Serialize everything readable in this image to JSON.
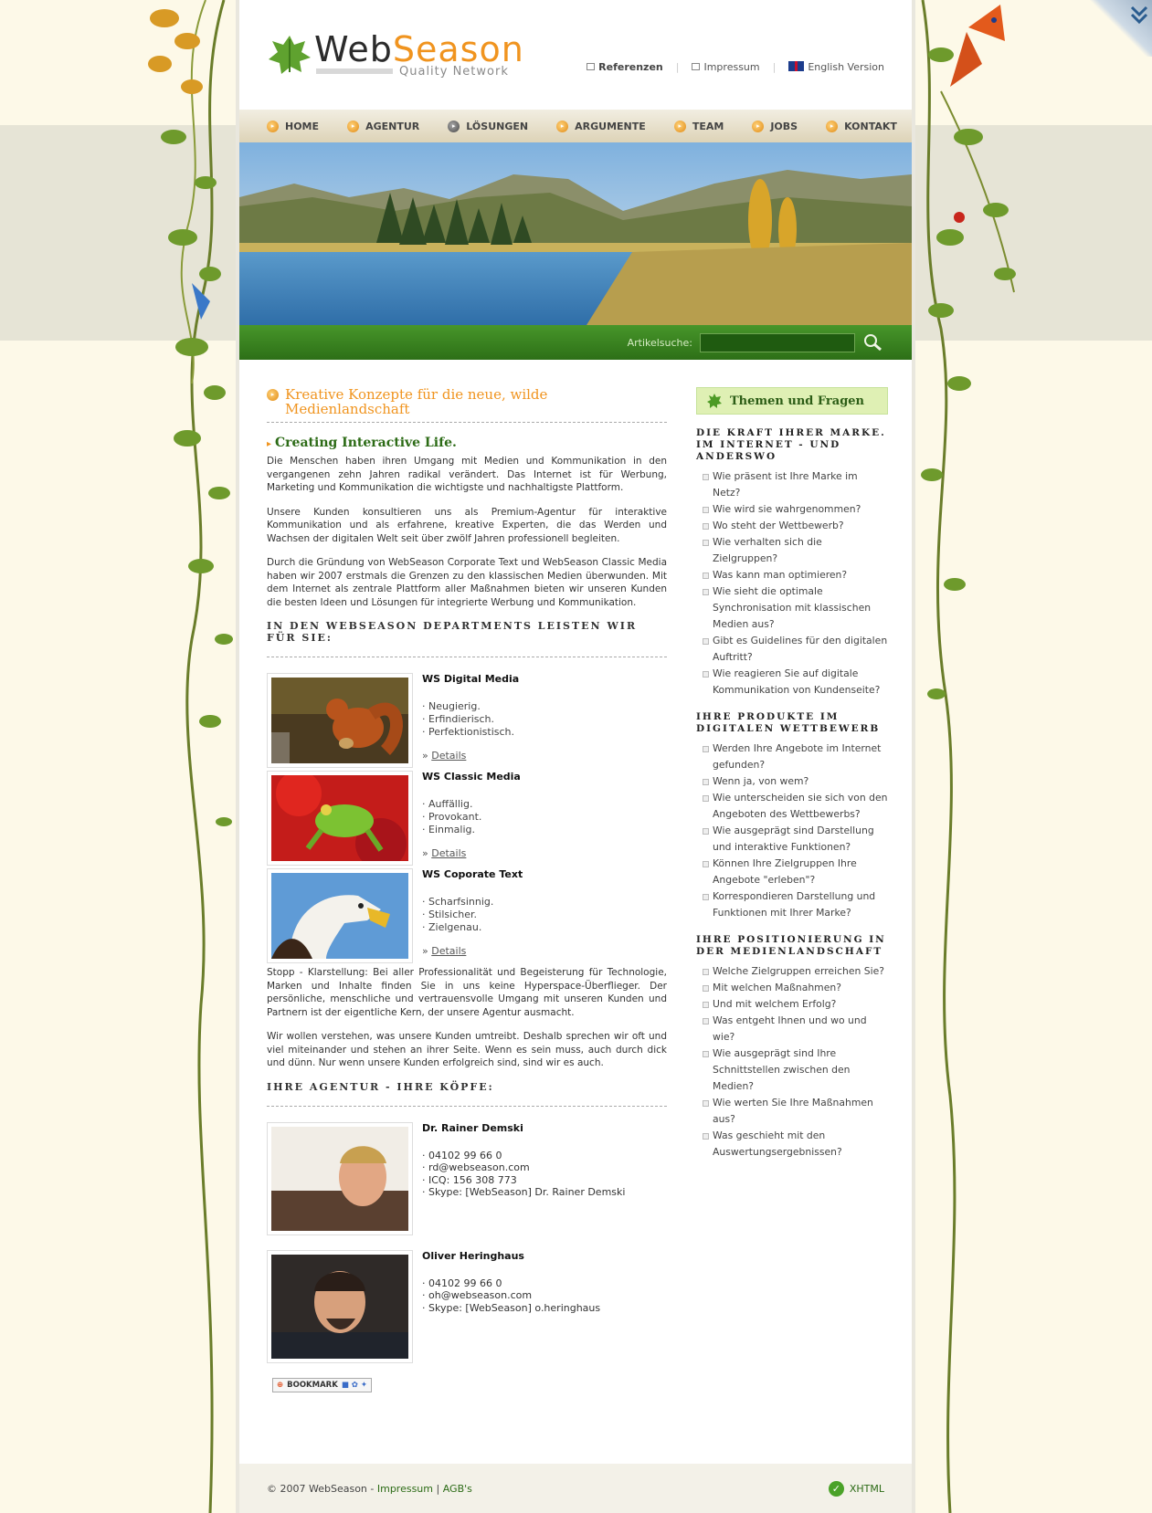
{
  "brand": {
    "name_part1": "Web",
    "name_part2": "Season",
    "tagline": "Quality Network"
  },
  "top_links": {
    "references": "Referenzen",
    "imprint": "Impressum",
    "english": "English Version"
  },
  "nav": [
    "HOME",
    "AGENTUR",
    "LÖSUNGEN",
    "ARGUMENTE",
    "TEAM",
    "JOBS",
    "KONTAKT"
  ],
  "nav_active": "LÖSUNGEN",
  "search": {
    "label": "Artikelsuche:",
    "value": ""
  },
  "content": {
    "heading": "Kreative Konzepte für die neue, wilde Medienlandschaft",
    "subheading": "Creating Interactive Life.",
    "para1": "Die Menschen haben ihren Umgang mit Medien und Kommunikation in den vergangenen zehn Jahren radikal verändert. Das Internet ist für Werbung, Marketing und Kommunikation die wichtigste und nachhaltigste Plattform.",
    "para2": "Unsere Kunden konsultieren uns als Premium-Agentur für interaktive Kommunikation und als erfahrene, kreative Experten, die das Werden und Wachsen der digitalen Welt seit über zwölf Jahren professionell begleiten.",
    "para3": "Durch die Gründung von WebSeason Corporate Text und WebSeason Classic Media haben wir 2007 erstmals die Grenzen zu den klassischen Medien überwunden. Mit dem Internet als zentrale Plattform aller Maßnahmen bieten wir unseren Kunden die besten Ideen und Lösungen für integrierte Werbung und Kommunikation.",
    "departments_heading": "IN DEN WEBSEASON DEPARTMENTS LEISTEN WIR FÜR SIE:",
    "departments": [
      {
        "name": "WS Digital Media",
        "lines": [
          "· Neugierig.",
          "· Erfindierisch.",
          "· Perfektionistisch."
        ],
        "details": "Details",
        "image": "squirrel"
      },
      {
        "name": "WS Classic Media",
        "lines": [
          "· Auffällig.",
          "· Provokant.",
          "· Einmalig."
        ],
        "details": "Details",
        "image": "frog"
      },
      {
        "name": "WS Coporate Text",
        "lines": [
          "· Scharfsinnig.",
          "· Stilsicher.",
          "· Zielgenau."
        ],
        "details": "Details",
        "image": "eagle"
      }
    ],
    "para4": "Stopp - Klarstellung: Bei aller Professionalität und Begeisterung für Technologie, Marken und Inhalte finden Sie in uns keine Hyperspace-Überflieger. Der persönliche, menschliche und vertrauensvolle Umgang mit unseren Kunden und Partnern ist der eigentliche Kern, der unsere Agentur ausmacht.",
    "para5": "Wir wollen verstehen, was unsere Kunden umtreibt. Deshalb sprechen wir oft und viel miteinander und stehen an ihrer Seite. Wenn es sein muss, auch durch dick und dünn. Nur wenn unsere Kunden erfolgreich sind, sind wir es auch.",
    "team_heading": "IHRE AGENTUR - IHRE KÖPFE:",
    "people": [
      {
        "name": "Dr. Rainer Demski",
        "lines": [
          "· 04102 99 66 0",
          "· rd@webseason.com",
          "· ICQ: 156 308 773",
          "· Skype: [WebSeason] Dr. Rainer Demski"
        ]
      },
      {
        "name": "Oliver Heringhaus",
        "lines": [
          "· 04102 99 66 0",
          "· oh@webseason.com",
          "· Skype: [WebSeason] o.heringhaus"
        ]
      }
    ],
    "bookmark": "BOOKMARK"
  },
  "sidebar": {
    "title": "Themen und Fragen",
    "sections": [
      {
        "title": "DIE KRAFT IHRER MARKE. IM INTERNET - UND ANDERSWO",
        "items": [
          "Wie präsent ist Ihre Marke im Netz?",
          "Wie wird sie wahrgenommen?",
          "Wo steht der Wettbewerb?",
          "Wie verhalten sich die Zielgruppen?",
          "Was kann man optimieren?",
          "Wie sieht die optimale Synchronisation mit klassischen Medien aus?",
          "Gibt es Guidelines für den digitalen Auftritt?",
          "Wie reagieren Sie auf digitale Kommunikation von Kundenseite?"
        ]
      },
      {
        "title": "IHRE PRODUKTE IM DIGITALEN WETTBEWERB",
        "items": [
          "Werden Ihre Angebote im Internet gefunden?",
          "Wenn ja, von wem?",
          "Wie unterscheiden sie sich von den Angeboten des Wettbewerbs?",
          "Wie ausgeprägt sind Darstellung und interaktive Funktionen?",
          "Können Ihre Zielgruppen Ihre Angebote \"erleben\"?",
          "Korrespondieren Darstellung und Funktionen mit Ihrer Marke?"
        ]
      },
      {
        "title": "IHRE POSITIONIERUNG IN DER MEDIENLANDSCHAFT",
        "items": [
          "Welche Zielgruppen erreichen Sie?",
          "Mit welchen Maßnahmen?",
          "Und mit welchem Erfolg?",
          "Was entgeht Ihnen und wo und wie?",
          "Wie ausgeprägt sind Ihre Schnittstellen zwischen den Medien?",
          "Wie werten Sie Ihre Maßnahmen aus?",
          "Was geschieht mit den Auswertungsergebnissen?"
        ]
      }
    ]
  },
  "footer": {
    "copyright": "© 2007 WebSeason -",
    "imprint": "Impressum",
    "separator": "|",
    "agb": "AGB's",
    "xhtml": "XHTML"
  },
  "colors": {
    "accent_orange": "#f0941f",
    "brand_green": "#2c6b16",
    "nav_bar": "#ddd3b7"
  }
}
